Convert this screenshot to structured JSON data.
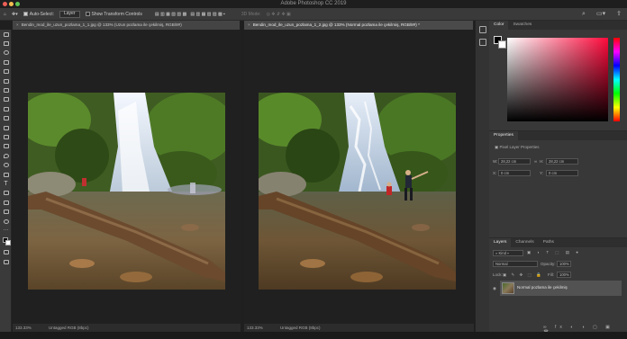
{
  "app": {
    "title": "Adobe Photoshop CC 2019"
  },
  "options_bar": {
    "auto_select_label": "Auto-Select:",
    "auto_select_value": "Layer",
    "transform_label": "Show Transform Controls",
    "mode_label": "3D Mode:"
  },
  "documents": [
    {
      "tab": "Bendin_mod_ile_uzun_pozlama_1_1.jpg @ 133% (Uzun pozlama ile çekilmiş, RGB/8#)",
      "zoom": "133.33%",
      "profile": "Untagged RGB (8bpc)"
    },
    {
      "tab": "Bendin_mod_ile_uzun_pozlama_1_2.jpg @ 133% (Normal pozlama ile çekilmiş, RGB/8#) *",
      "zoom": "133.33%",
      "profile": "Untagged RGB (8bpc)"
    }
  ],
  "color_panel": {
    "tabs": [
      "Color",
      "Swatches"
    ]
  },
  "properties_panel": {
    "title": "Properties",
    "subtitle": "Pixel Layer Properties",
    "w_label": "W:",
    "w_value": "28,22 cm",
    "h_label": "H:",
    "h_value": "28,22 cm",
    "x_label": "X:",
    "x_value": "0 cm",
    "y_label": "Y:",
    "y_value": "0 cm"
  },
  "layers_panel": {
    "tabs": [
      "Layers",
      "Channels",
      "Paths"
    ],
    "kind": "Kind",
    "blend_mode": "Normal",
    "opacity_label": "Opacity:",
    "opacity_value": "100%",
    "lock_label": "Lock:",
    "fill_label": "Fill:",
    "fill_value": "100%",
    "layer_name": "Normal pozlama ile çekilmiş"
  },
  "colors": {
    "accent": "#2d7df6",
    "foreground": "#000000",
    "background": "#ffffff"
  }
}
